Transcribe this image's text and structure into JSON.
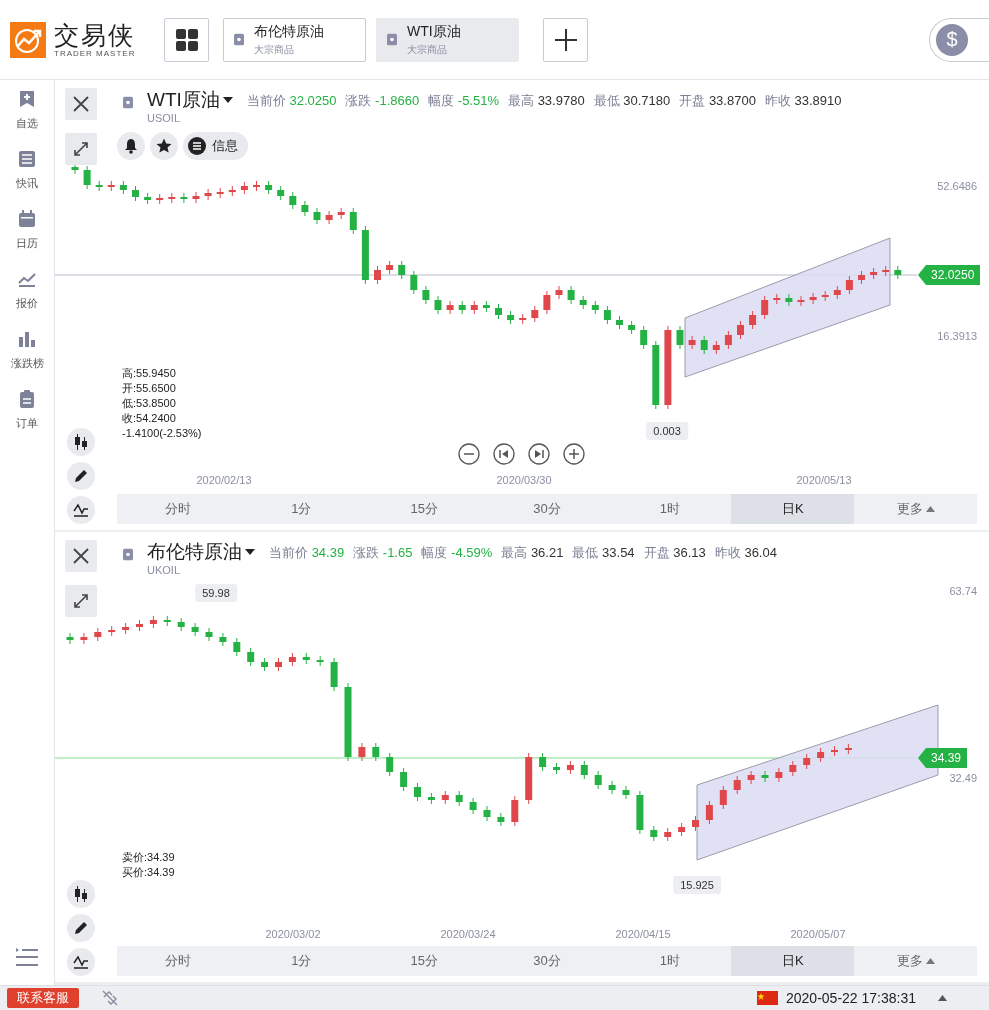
{
  "header": {
    "logo_name": "交易侠",
    "logo_tagline": "TRADER MASTER",
    "wallet_symbol": "$",
    "tabs": [
      {
        "name": "布伦特原油",
        "category": "大宗商品",
        "selected": false
      },
      {
        "name": "WTI原油",
        "category": "大宗商品",
        "selected": true
      }
    ]
  },
  "sidebar": {
    "items": [
      {
        "kind": "watchlist",
        "label": "自选"
      },
      {
        "kind": "news",
        "label": "快讯"
      },
      {
        "kind": "calendar",
        "label": "日历"
      },
      {
        "kind": "quotes",
        "label": "报价"
      },
      {
        "kind": "ranking",
        "label": "涨跌榜"
      },
      {
        "kind": "orders",
        "label": "订单"
      }
    ]
  },
  "panels": [
    {
      "name": "WTI原油",
      "code": "USOIL",
      "quotes": [
        {
          "label": "当前价",
          "value": "32.0250",
          "color": "#23b243"
        },
        {
          "label": "涨跌",
          "value": "-1.8660",
          "color": "#23b243"
        },
        {
          "label": "幅度",
          "value": "-5.51%",
          "color": "#23b243"
        },
        {
          "label": "最高",
          "value": "33.9780",
          "color": "#333333"
        },
        {
          "label": "最低",
          "value": "30.7180",
          "color": "#333333"
        },
        {
          "label": "开盘",
          "value": "33.8700",
          "color": "#333333"
        },
        {
          "label": "昨收",
          "value": "33.8910",
          "color": "#333333"
        }
      ],
      "actions": [
        {
          "kind": "alert"
        },
        {
          "kind": "star"
        },
        {
          "kind": "info",
          "label": "信息"
        }
      ],
      "info_lines": [
        "高:55.9450",
        "开:55.6500",
        "低:53.8500",
        "收:54.2400",
        "-1.4100(-2.53%)"
      ],
      "price_axis": [
        "52.6486",
        "16.3913"
      ],
      "current_price": "32.0250",
      "markers": [
        "0.003"
      ],
      "dates": [
        "2020/02/13",
        "2020/03/30",
        "2020/05/13"
      ],
      "zoom_controls": true,
      "timeframes": [
        {
          "label": "分时",
          "selected": false
        },
        {
          "label": "1分",
          "selected": false
        },
        {
          "label": "15分",
          "selected": false
        },
        {
          "label": "30分",
          "selected": false
        },
        {
          "label": "1时",
          "selected": false
        },
        {
          "label": "日K",
          "selected": true
        },
        {
          "label": "更多",
          "selected": false
        }
      ]
    },
    {
      "name": "布伦特原油",
      "code": "UKOIL",
      "quotes": [
        {
          "label": "当前价",
          "value": "34.39",
          "color": "#23b243"
        },
        {
          "label": "涨跌",
          "value": "-1.65",
          "color": "#23b243"
        },
        {
          "label": "幅度",
          "value": "-4.59%",
          "color": "#23b243"
        },
        {
          "label": "最高",
          "value": "36.21",
          "color": "#333333"
        },
        {
          "label": "最低",
          "value": "33.54",
          "color": "#333333"
        },
        {
          "label": "开盘",
          "value": "36.13",
          "color": "#333333"
        },
        {
          "label": "昨收",
          "value": "36.04",
          "color": "#333333"
        }
      ],
      "info_lines": [
        "卖价:34.39",
        "买价:34.39"
      ],
      "price_axis": [
        "63.74",
        "32.49"
      ],
      "current_price": "34.39",
      "markers": [
        "59.98",
        "15.925"
      ],
      "dates": [
        "2020/03/02",
        "2020/03/24",
        "2020/04/15",
        "2020/05/07"
      ],
      "timeframes": [
        {
          "label": "分时",
          "selected": false
        },
        {
          "label": "1分",
          "selected": false
        },
        {
          "label": "15分",
          "selected": false
        },
        {
          "label": "30分",
          "selected": false
        },
        {
          "label": "1时",
          "selected": false
        },
        {
          "label": "日K",
          "selected": true
        },
        {
          "label": "更多",
          "selected": false
        }
      ]
    }
  ],
  "status_bar": {
    "support_button": "联系客服",
    "datetime": "2020-05-22 17:38:31"
  }
}
